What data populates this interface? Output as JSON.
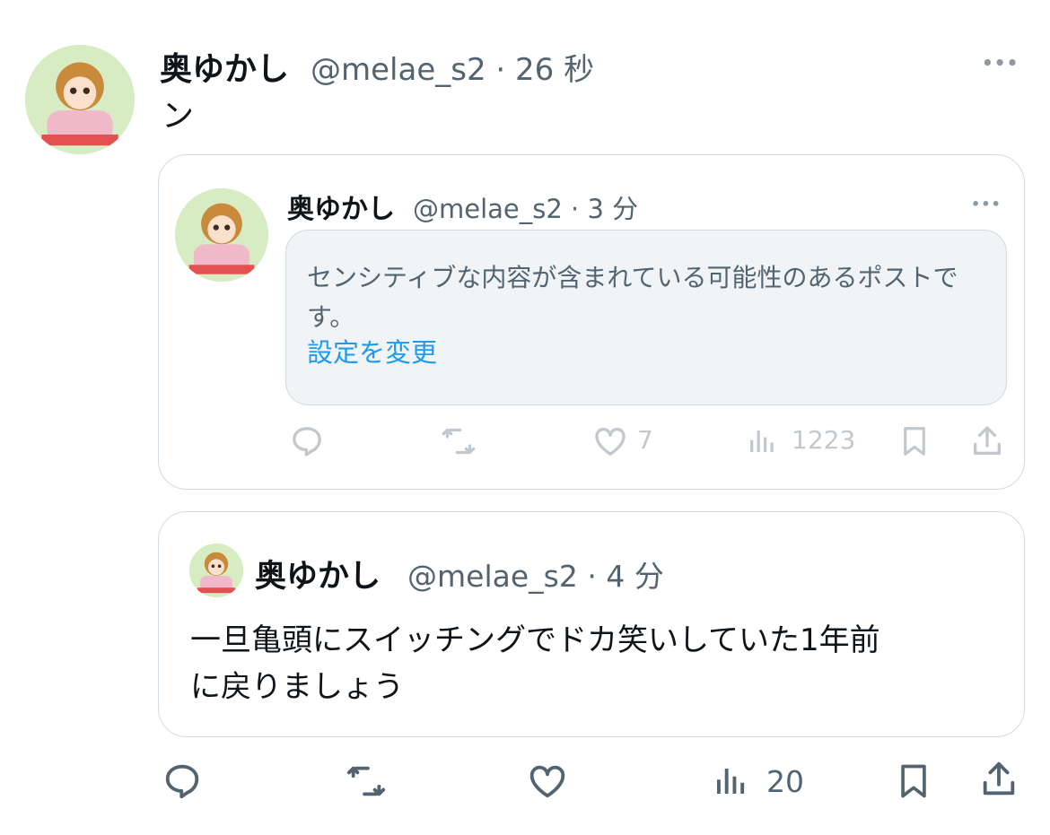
{
  "main_post": {
    "author_name": "奥ゆかし",
    "handle": "@melae_s2",
    "separator": "·",
    "time": "26 秒",
    "text": "ン",
    "more": "•••",
    "actions": {
      "views": "20"
    }
  },
  "quoted_post_1": {
    "author_name": "奥ゆかし",
    "handle": "@melae_s2",
    "separator": "·",
    "time": "3 分",
    "more": "•••",
    "sensitive_notice": "センシティブな内容が含まれている可能性のあるポストです。",
    "settings_link": "設定を変更",
    "actions": {
      "likes": "7",
      "views": "1223"
    }
  },
  "quoted_post_2": {
    "author_name": "奥ゆかし",
    "handle": "@melae_s2",
    "separator": "·",
    "time": "4 分",
    "text_line1": "一旦亀頭にスイッチングでドカ笑いしていた1年前",
    "text_line2": "に戻りましょう"
  },
  "colors": {
    "link": "#1d9bf0",
    "muted": "#536471",
    "border": "#cfd9de"
  },
  "icons": [
    "reply-icon",
    "retweet-icon",
    "like-icon",
    "views-icon",
    "bookmark-icon",
    "share-icon",
    "more-icon"
  ]
}
